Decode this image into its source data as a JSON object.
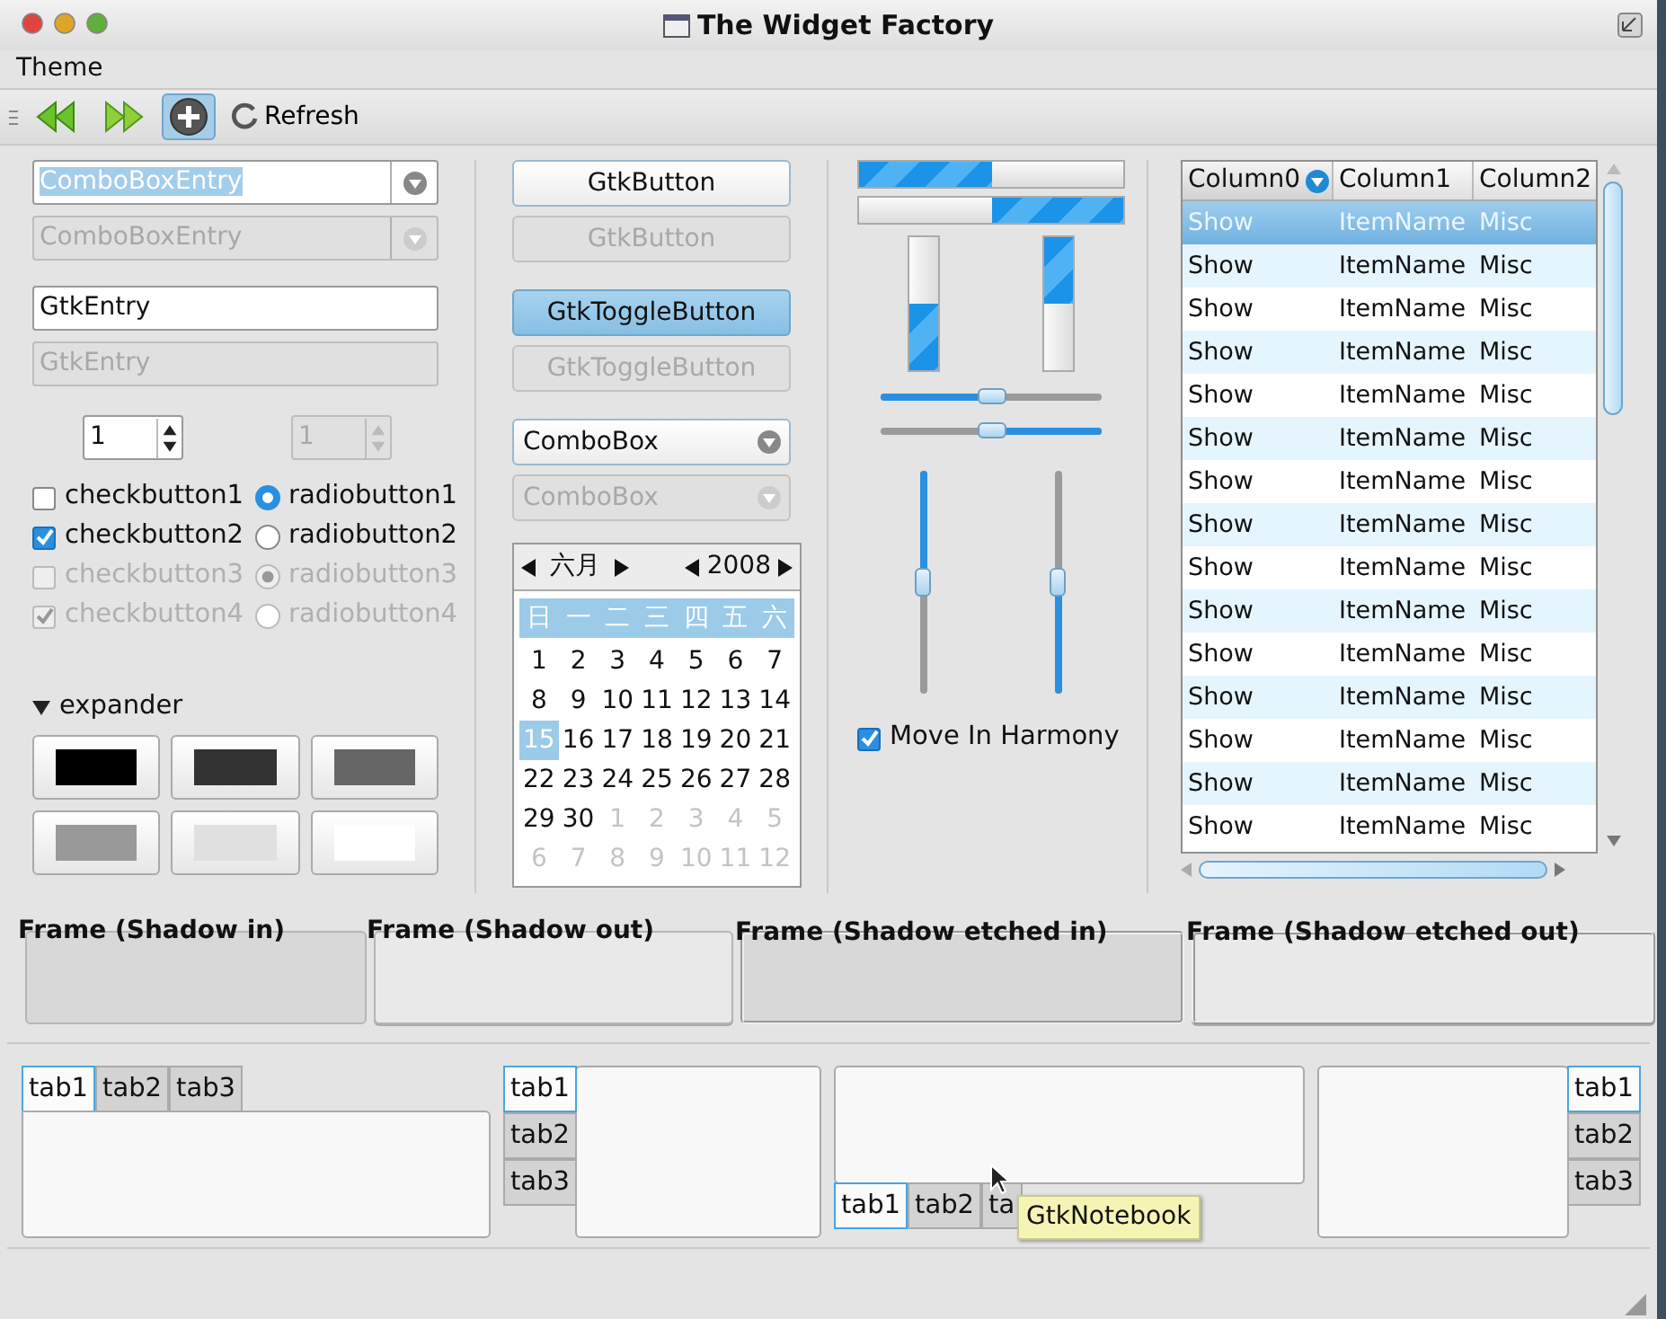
{
  "window": {
    "title": "The Widget Factory"
  },
  "menu": [
    "Theme"
  ],
  "toolbar": [
    {
      "kind": "back"
    },
    {
      "kind": "forward"
    },
    {
      "kind": "add",
      "selected": true
    },
    {
      "kind": "refresh",
      "label": "Refresh"
    }
  ],
  "combo_entries": [
    {
      "value": "ComboBoxEntry",
      "disabled": false,
      "text_selected": true
    },
    {
      "value": "ComboBoxEntry",
      "disabled": true,
      "text_selected": false
    }
  ],
  "entries": [
    {
      "value": "GtkEntry",
      "disabled": false
    },
    {
      "value": "GtkEntry",
      "disabled": true
    }
  ],
  "spin_buttons": [
    {
      "value": "1",
      "disabled": false
    },
    {
      "value": "1",
      "disabled": true
    }
  ],
  "check_buttons": [
    {
      "label": "checkbutton1",
      "checked": false,
      "disabled": false
    },
    {
      "label": "checkbutton2",
      "checked": true,
      "disabled": false
    },
    {
      "label": "checkbutton3",
      "checked": false,
      "disabled": true
    },
    {
      "label": "checkbutton4",
      "checked": true,
      "disabled": true
    }
  ],
  "radio_buttons": [
    {
      "label": "radiobutton1",
      "selected": true,
      "disabled": false
    },
    {
      "label": "radiobutton2",
      "selected": false,
      "disabled": false
    },
    {
      "label": "radiobutton3",
      "selected": true,
      "disabled": true
    },
    {
      "label": "radiobutton4",
      "selected": false,
      "disabled": true
    }
  ],
  "expander": {
    "label": "expander",
    "expanded": true
  },
  "color_buttons": [
    {
      "color": "#000000"
    },
    {
      "color": "#333333"
    },
    {
      "color": "#666666"
    },
    {
      "color": "#999999"
    },
    {
      "color": "#e0e0e0"
    },
    {
      "color": "#ffffff"
    }
  ],
  "buttons": [
    {
      "label": "GtkButton",
      "disabled": false
    },
    {
      "label": "GtkButton",
      "disabled": true
    }
  ],
  "toggle_buttons": [
    {
      "label": "GtkToggleButton",
      "active": true,
      "disabled": false
    },
    {
      "label": "GtkToggleButton",
      "active": false,
      "disabled": true
    }
  ],
  "combo_boxes": [
    {
      "value": "ComboBox",
      "disabled": false
    },
    {
      "value": "ComboBox",
      "disabled": true
    }
  ],
  "calendar": {
    "month": "六月",
    "year": "2008",
    "weekdays": [
      "日",
      "一",
      "二",
      "三",
      "四",
      "五",
      "六"
    ],
    "weeks": [
      {
        "days": [
          {
            "label": "1",
            "selected": false,
            "other_month": false
          },
          {
            "label": "2",
            "selected": false,
            "other_month": false
          },
          {
            "label": "3",
            "selected": false,
            "other_month": false
          },
          {
            "label": "4",
            "selected": false,
            "other_month": false
          },
          {
            "label": "5",
            "selected": false,
            "other_month": false
          },
          {
            "label": "6",
            "selected": false,
            "other_month": false
          },
          {
            "label": "7",
            "selected": false,
            "other_month": false
          }
        ]
      },
      {
        "days": [
          {
            "label": "8",
            "selected": false,
            "other_month": false
          },
          {
            "label": "9",
            "selected": false,
            "other_month": false
          },
          {
            "label": "10",
            "selected": false,
            "other_month": false
          },
          {
            "label": "11",
            "selected": false,
            "other_month": false
          },
          {
            "label": "12",
            "selected": false,
            "other_month": false
          },
          {
            "label": "13",
            "selected": false,
            "other_month": false
          },
          {
            "label": "14",
            "selected": false,
            "other_month": false
          }
        ]
      },
      {
        "days": [
          {
            "label": "15",
            "selected": true,
            "other_month": false
          },
          {
            "label": "16",
            "selected": false,
            "other_month": false
          },
          {
            "label": "17",
            "selected": false,
            "other_month": false
          },
          {
            "label": "18",
            "selected": false,
            "other_month": false
          },
          {
            "label": "19",
            "selected": false,
            "other_month": false
          },
          {
            "label": "20",
            "selected": false,
            "other_month": false
          },
          {
            "label": "21",
            "selected": false,
            "other_month": false
          }
        ]
      },
      {
        "days": [
          {
            "label": "22",
            "selected": false,
            "other_month": false
          },
          {
            "label": "23",
            "selected": false,
            "other_month": false
          },
          {
            "label": "24",
            "selected": false,
            "other_month": false
          },
          {
            "label": "25",
            "selected": false,
            "other_month": false
          },
          {
            "label": "26",
            "selected": false,
            "other_month": false
          },
          {
            "label": "27",
            "selected": false,
            "other_month": false
          },
          {
            "label": "28",
            "selected": false,
            "other_month": false
          }
        ]
      },
      {
        "days": [
          {
            "label": "29",
            "selected": false,
            "other_month": false
          },
          {
            "label": "30",
            "selected": false,
            "other_month": false
          },
          {
            "label": "1",
            "selected": false,
            "other_month": true
          },
          {
            "label": "2",
            "selected": false,
            "other_month": true
          },
          {
            "label": "3",
            "selected": false,
            "other_month": true
          },
          {
            "label": "4",
            "selected": false,
            "other_month": true
          },
          {
            "label": "5",
            "selected": false,
            "other_month": true
          }
        ]
      },
      {
        "days": [
          {
            "label": "6",
            "selected": false,
            "other_month": true
          },
          {
            "label": "7",
            "selected": false,
            "other_month": true
          },
          {
            "label": "8",
            "selected": false,
            "other_month": true
          },
          {
            "label": "9",
            "selected": false,
            "other_month": true
          },
          {
            "label": "10",
            "selected": false,
            "other_month": true
          },
          {
            "label": "11",
            "selected": false,
            "other_month": true
          },
          {
            "label": "12",
            "selected": false,
            "other_month": true
          }
        ]
      }
    ]
  },
  "horizontal_progress_bars": [
    {
      "level": 0.5,
      "inverted": false
    },
    {
      "level": 0.5,
      "inverted": true
    }
  ],
  "vertical_progress_bars": [
    {
      "level": 0.5,
      "inverted": false
    },
    {
      "level": 0.5,
      "inverted": true
    }
  ],
  "horizontal_scales": [
    {
      "level": 0.5,
      "inverted": false
    },
    {
      "level": 0.5,
      "inverted": true
    }
  ],
  "vertical_scales": [
    {
      "level": 0.5,
      "inverted": false
    },
    {
      "level": 0.5,
      "inverted": true
    }
  ],
  "harmony_check": {
    "label": "Move In Harmony",
    "checked": true
  },
  "tree": {
    "columns": [
      {
        "label": "Column0",
        "sorted": true
      },
      {
        "label": "Column1",
        "sorted": false
      },
      {
        "label": "Column2",
        "sorted": false
      }
    ],
    "rows": [
      {
        "cells": [
          "Show",
          "ItemName",
          "Misc"
        ],
        "selected": true
      },
      {
        "cells": [
          "Show",
          "ItemName",
          "Misc"
        ],
        "selected": false
      },
      {
        "cells": [
          "Show",
          "ItemName",
          "Misc"
        ],
        "selected": false
      },
      {
        "cells": [
          "Show",
          "ItemName",
          "Misc"
        ],
        "selected": false
      },
      {
        "cells": [
          "Show",
          "ItemName",
          "Misc"
        ],
        "selected": false
      },
      {
        "cells": [
          "Show",
          "ItemName",
          "Misc"
        ],
        "selected": false
      },
      {
        "cells": [
          "Show",
          "ItemName",
          "Misc"
        ],
        "selected": false
      },
      {
        "cells": [
          "Show",
          "ItemName",
          "Misc"
        ],
        "selected": false
      },
      {
        "cells": [
          "Show",
          "ItemName",
          "Misc"
        ],
        "selected": false
      },
      {
        "cells": [
          "Show",
          "ItemName",
          "Misc"
        ],
        "selected": false
      },
      {
        "cells": [
          "Show",
          "ItemName",
          "Misc"
        ],
        "selected": false
      },
      {
        "cells": [
          "Show",
          "ItemName",
          "Misc"
        ],
        "selected": false
      },
      {
        "cells": [
          "Show",
          "ItemName",
          "Misc"
        ],
        "selected": false
      },
      {
        "cells": [
          "Show",
          "ItemName",
          "Misc"
        ],
        "selected": false
      },
      {
        "cells": [
          "Show",
          "ItemName",
          "Misc"
        ],
        "selected": false
      }
    ]
  },
  "frames": [
    {
      "label": "Frame (Shadow in)",
      "kind": "in"
    },
    {
      "label": "Frame (Shadow out)",
      "kind": "out"
    },
    {
      "label": "Frame (Shadow etched in)",
      "kind": "groove"
    },
    {
      "label": "Frame (Shadow etched out)",
      "kind": "ridge"
    }
  ],
  "notebooks": [
    {
      "kind": "top",
      "tabs": [
        {
          "label": "tab1",
          "selected": true
        },
        {
          "label": "tab2",
          "selected": false
        },
        {
          "label": "tab3",
          "selected": false
        }
      ]
    },
    {
      "kind": "left",
      "tabs": [
        {
          "label": "tab1",
          "selected": true
        },
        {
          "label": "tab2",
          "selected": false
        },
        {
          "label": "tab3",
          "selected": false
        }
      ]
    },
    {
      "kind": "bottom",
      "tabs": [
        {
          "label": "tab1",
          "selected": true
        },
        {
          "label": "tab2",
          "selected": false
        },
        {
          "label": "ta",
          "selected": false
        }
      ]
    },
    {
      "kind": "right",
      "tabs": [
        {
          "label": "tab1",
          "selected": true
        },
        {
          "label": "tab2",
          "selected": false
        },
        {
          "label": "tab3",
          "selected": false
        }
      ]
    }
  ],
  "tooltip": {
    "text": "GtkNotebook"
  }
}
